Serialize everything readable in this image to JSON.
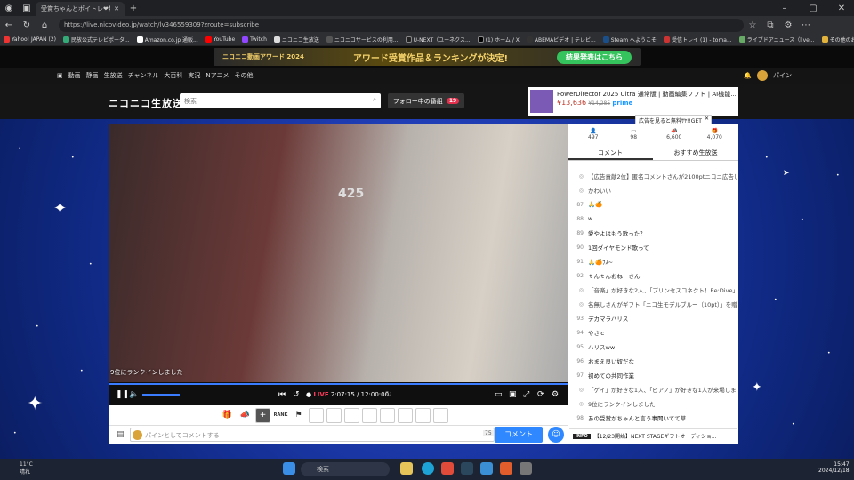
{
  "browser": {
    "tab_title": "受賞ちゃんとポイトレ❤無料広...",
    "url": "https://live.nicovideo.jp/watch/lv346559309?zroute=subscribe",
    "bookmarks": [
      "Yahoo! JAPAN (2)",
      "民放公式テレビポータ...",
      "Amazon.co.jp 通販...",
      "YouTube",
      "Twitch",
      "ニコニコ生放送",
      "ニコニコサービスの利用...",
      "U-NEXT（ユーネクス...",
      "(1) ホーム / X",
      "ABEMAビデオ | テレビ...",
      "Steam へようこそ",
      "受信トレイ (1) - toma...",
      "ライブドアニュース（live..."
    ],
    "bookmark_folder": "その他のお気に入り"
  },
  "nico": {
    "award_small": "ニコニコ動画アワード 2024",
    "award_title": "アワード受賞作品＆ランキングが決定!",
    "award_button": "結果発表はこちら",
    "nav": [
      "動画",
      "静画",
      "生放送",
      "チャンネル",
      "大百科",
      "実況",
      "Nアニメ",
      "その他"
    ],
    "user": "パイン",
    "logo": "ニコニコ生放送",
    "search_placeholder": "検索",
    "follow_label": "フォロー中の番組",
    "follow_count": "19"
  },
  "ad": {
    "title": "PowerDirector 2025 Ultra 通常版 | 動画編集ソフト | AI機能...",
    "price": "¥13,636",
    "old_price": "¥14,285",
    "prime": "prime"
  },
  "promo": "広告を見ると無料ｻﾔ!!GET",
  "player": {
    "overlay_text": "9位にランクインしました",
    "room_number": "425",
    "live_label": "LIVE",
    "time": "2:07:15 / 12:00:00"
  },
  "stats": [
    {
      "icon": "person-icon",
      "value": "497"
    },
    {
      "icon": "comment-icon",
      "value": "98"
    },
    {
      "icon": "ad-icon",
      "value": "6,600"
    },
    {
      "icon": "gift-icon",
      "value": "4,070"
    }
  ],
  "side_tabs": [
    "コメント",
    "おすすめ生放送"
  ],
  "comments": [
    {
      "n": "",
      "text": "【広告貢献2位】匿名コメントさんが2100ptニコニ広告し",
      "sys": true
    },
    {
      "n": "",
      "text": "かわいい",
      "sys": true
    },
    {
      "n": "87",
      "text": "🙏🍊"
    },
    {
      "n": "88",
      "text": "w"
    },
    {
      "n": "89",
      "text": "愛やよはもう歌った？"
    },
    {
      "n": "90",
      "text": "1回ダイヤモンド歌って"
    },
    {
      "n": "91",
      "text": "🙏🍊ﾌｽ~"
    },
    {
      "n": "92",
      "text": "ｔんｔんおねーさん"
    },
    {
      "n": "",
      "text": "「音楽」が好きな2人、「プリンセスコネクト！Re:Dive」が好き",
      "sys": true
    },
    {
      "n": "",
      "text": "名無しさんがギフト「ニコ生モデルブルー（10pt）」を贈り",
      "sys": true
    },
    {
      "n": "93",
      "text": "デカマラハリス"
    },
    {
      "n": "94",
      "text": "やさｃ"
    },
    {
      "n": "95",
      "text": "ハリスww"
    },
    {
      "n": "96",
      "text": "おまえ良い奴だな"
    },
    {
      "n": "97",
      "text": "初めての共同作業"
    },
    {
      "n": "",
      "text": "「ゲイ」が好きな1人、「ピアノ」が好きな1人が来場しました",
      "sys": true
    },
    {
      "n": "",
      "text": "9位にランクインしました",
      "sys": true
    },
    {
      "n": "98",
      "text": "あの受賞がちゃんと言う事聞いてて草"
    }
  ],
  "info": {
    "badge": "INFO",
    "text": "【12/23開始】NEXT STAGEギフトオーディショ..."
  },
  "comment_input": {
    "placeholder": "パインとしてコメントする",
    "count": "75",
    "send": "コメント"
  },
  "gift_labels": {
    "rank": "RANK"
  },
  "taskbar": {
    "temp": "11°C",
    "weather": "晴れ",
    "search": "検索",
    "time": "15:47",
    "date": "2024/12/18"
  }
}
